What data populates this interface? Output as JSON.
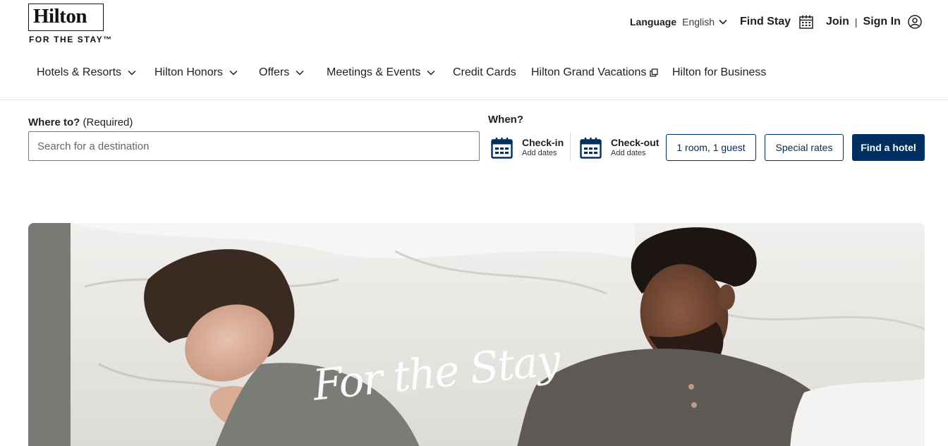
{
  "brand": {
    "name": "Hilton",
    "tagline": "FOR THE STAY™"
  },
  "utility": {
    "language_label": "Language",
    "language_value": "English",
    "find_stay": "Find Stay",
    "join": "Join",
    "separator": "|",
    "sign_in": "Sign In"
  },
  "nav": {
    "items": [
      {
        "label": "Hotels & Resorts",
        "has_menu": true
      },
      {
        "label": "Hilton Honors",
        "has_menu": true
      },
      {
        "label": "Offers",
        "has_menu": true
      },
      {
        "label": "Meetings & Events",
        "has_menu": true
      },
      {
        "label": "Credit Cards",
        "has_menu": false
      },
      {
        "label": "Hilton Grand Vacations",
        "has_menu": false,
        "icon": "external-link-icon"
      },
      {
        "label": "Hilton for Business",
        "has_menu": false
      }
    ]
  },
  "search": {
    "where_label": "Where to?",
    "where_required": "(Required)",
    "where_placeholder": "Search for a destination",
    "when_label": "When?",
    "check_in_label": "Check-in",
    "check_in_sub": "Add dates",
    "check_out_label": "Check-out",
    "check_out_sub": "Add dates",
    "rooms_button": "1 room, 1 guest",
    "special_rates_button": "Special rates",
    "find_hotel_button": "Find a hotel"
  },
  "hero": {
    "script_text": "For the Stay"
  },
  "colors": {
    "brand_navy": "#002f61",
    "text": "#1f1f1f",
    "border": "#7a7a7a"
  }
}
